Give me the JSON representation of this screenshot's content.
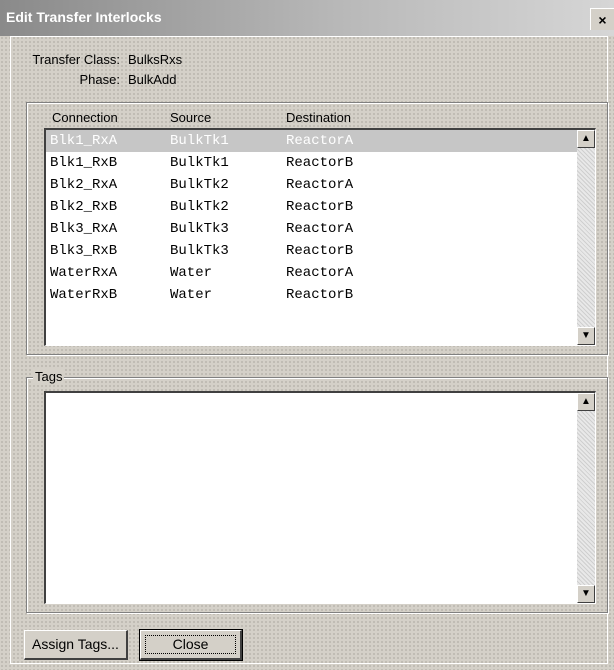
{
  "window": {
    "title": "Edit Transfer Interlocks",
    "close_glyph": "×"
  },
  "info": {
    "transfer_class_label": "Transfer Class:",
    "transfer_class_value": "BulksRxs",
    "phase_label": "Phase:",
    "phase_value": "BulkAdd"
  },
  "connections": {
    "headers": [
      "Connection",
      "Source",
      "Destination"
    ],
    "rows": [
      {
        "connection": "Blk1_RxA",
        "source": "BulkTk1",
        "destination": "ReactorA",
        "selected": true
      },
      {
        "connection": "Blk1_RxB",
        "source": "BulkTk1",
        "destination": "ReactorB"
      },
      {
        "connection": "Blk2_RxA",
        "source": "BulkTk2",
        "destination": "ReactorA"
      },
      {
        "connection": "Blk2_RxB",
        "source": "BulkTk2",
        "destination": "ReactorB"
      },
      {
        "connection": "Blk3_RxA",
        "source": "BulkTk3",
        "destination": "ReactorA"
      },
      {
        "connection": "Blk3_RxB",
        "source": "BulkTk3",
        "destination": "ReactorB"
      },
      {
        "connection": "WaterRxA",
        "source": "Water",
        "destination": "ReactorA"
      },
      {
        "connection": "WaterRxB",
        "source": "Water",
        "destination": "ReactorB"
      }
    ]
  },
  "tags": {
    "caption": "Tags",
    "items": []
  },
  "buttons": {
    "assign_tags": "Assign Tags...",
    "close": "Close"
  },
  "icons": {
    "scroll_up": "scroll-up-arrow-icon",
    "scroll_down": "scroll-down-arrow-icon"
  }
}
